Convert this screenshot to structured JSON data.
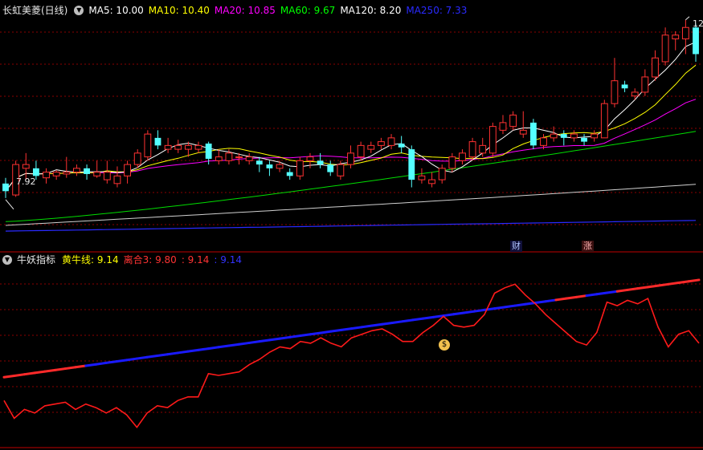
{
  "main_header": {
    "title": "长虹美菱(日线)",
    "ma": [
      {
        "label": "MA5: 10.00",
        "color": "#ffffff"
      },
      {
        "label": "MA10: 10.40",
        "color": "#ffff00"
      },
      {
        "label": "MA20: 10.85",
        "color": "#ff00ff"
      },
      {
        "label": "MA60: 9.67",
        "color": "#00ff00"
      },
      {
        "label": "MA120: 8.20",
        "color": "#ffffff"
      },
      {
        "label": "MA250: 7.33",
        "color": "#0000ff"
      }
    ]
  },
  "sub_header": {
    "title": "牛妖指标",
    "items": [
      {
        "label": "黄牛线: 9.14",
        "color": "#ffff00"
      },
      {
        "label": "离合3: 9.80",
        "color": "#ff3333"
      },
      {
        "label": ": 9.14",
        "color": "#ff3333"
      },
      {
        "label": ": 9.14",
        "color": "#3333ff"
      }
    ]
  },
  "badges": {
    "cai": "财",
    "zhang": "涨",
    "money": "$"
  },
  "price_labels": {
    "low": "7.92",
    "high": "12"
  },
  "colors": {
    "up": "#ff3232",
    "down": "#54ffff",
    "grid": "#8b0000",
    "border": "#c00000"
  },
  "chart_data": [
    {
      "type": "candlestick",
      "title": "长虹美菱(日线)",
      "ylim": [
        6.8,
        12.7
      ],
      "low_marker": 7.92,
      "high_marker": 12,
      "candles": [
        [
          8.3,
          8.1,
          8.45,
          7.92
        ],
        [
          8.0,
          8.8,
          8.9,
          7.95
        ],
        [
          8.7,
          8.8,
          9.1,
          8.4
        ],
        [
          8.7,
          8.5,
          8.9,
          8.4
        ],
        [
          8.45,
          8.6,
          8.7,
          8.3
        ],
        [
          8.5,
          8.6,
          8.65,
          8.4
        ],
        [
          8.55,
          8.6,
          9.0,
          8.45
        ],
        [
          8.6,
          8.7,
          8.8,
          8.5
        ],
        [
          8.7,
          8.55,
          8.8,
          8.4
        ],
        [
          8.5,
          8.6,
          8.9,
          8.45
        ],
        [
          8.4,
          8.6,
          8.9,
          8.3
        ],
        [
          8.3,
          8.5,
          8.75,
          8.2
        ],
        [
          8.5,
          8.8,
          8.9,
          8.3
        ],
        [
          8.8,
          9.1,
          9.2,
          8.7
        ],
        [
          9.0,
          9.6,
          9.7,
          8.9
        ],
        [
          9.5,
          9.3,
          9.7,
          9.2
        ],
        [
          9.2,
          9.3,
          9.5,
          9.1
        ],
        [
          9.2,
          9.3,
          9.45,
          9.1
        ],
        [
          9.2,
          9.3,
          9.4,
          9.0
        ],
        [
          9.2,
          9.3,
          9.4,
          9.1
        ],
        [
          9.35,
          8.95,
          9.4,
          8.8
        ],
        [
          8.9,
          9.0,
          9.2,
          8.8
        ],
        [
          8.9,
          9.1,
          9.2,
          8.8
        ],
        [
          9.0,
          9.0,
          9.1,
          8.8
        ],
        [
          8.9,
          9.0,
          9.1,
          8.8
        ],
        [
          8.9,
          8.8,
          9.0,
          8.6
        ],
        [
          8.8,
          8.7,
          8.9,
          8.5
        ],
        [
          8.7,
          8.8,
          8.9,
          8.6
        ],
        [
          8.6,
          8.5,
          8.7,
          8.4
        ],
        [
          8.5,
          8.9,
          9.0,
          8.4
        ],
        [
          8.9,
          9.0,
          9.1,
          8.7
        ],
        [
          8.9,
          8.8,
          9.1,
          8.7
        ],
        [
          8.8,
          8.6,
          8.9,
          8.5
        ],
        [
          8.5,
          8.8,
          8.9,
          8.4
        ],
        [
          8.8,
          9.1,
          9.3,
          8.7
        ],
        [
          9.0,
          9.3,
          9.4,
          8.9
        ],
        [
          9.2,
          9.3,
          9.4,
          9.1
        ],
        [
          9.3,
          9.4,
          9.5,
          9.2
        ],
        [
          9.3,
          9.5,
          9.6,
          9.2
        ],
        [
          9.35,
          9.25,
          9.55,
          9.1
        ],
        [
          9.2,
          8.4,
          9.3,
          8.2
        ],
        [
          8.4,
          8.5,
          8.7,
          8.3
        ],
        [
          8.3,
          8.4,
          8.6,
          8.2
        ],
        [
          8.4,
          8.7,
          8.8,
          8.3
        ],
        [
          8.7,
          9.0,
          9.1,
          8.6
        ],
        [
          8.9,
          9.1,
          9.2,
          8.8
        ],
        [
          9.0,
          9.4,
          9.5,
          8.9
        ],
        [
          9.1,
          9.3,
          9.5,
          9.0
        ],
        [
          9.1,
          9.8,
          9.9,
          9.0
        ],
        [
          9.7,
          9.9,
          10.1,
          9.6
        ],
        [
          9.8,
          10.1,
          10.2,
          9.7
        ],
        [
          9.6,
          9.7,
          10.2,
          9.5
        ],
        [
          9.9,
          9.3,
          10.0,
          9.2
        ],
        [
          9.3,
          9.5,
          9.6,
          9.2
        ],
        [
          9.5,
          9.6,
          9.8,
          9.4
        ],
        [
          9.6,
          9.5,
          9.7,
          9.3
        ],
        [
          9.5,
          9.6,
          9.7,
          9.4
        ],
        [
          9.5,
          9.4,
          9.6,
          9.3
        ],
        [
          9.5,
          9.6,
          9.7,
          9.4
        ],
        [
          9.5,
          10.4,
          10.5,
          9.5
        ],
        [
          10.4,
          11.0,
          11.6,
          10.3
        ],
        [
          10.9,
          10.8,
          11.0,
          10.7
        ],
        [
          10.6,
          10.7,
          10.8,
          10.5
        ],
        [
          10.7,
          11.1,
          11.3,
          10.6
        ],
        [
          11.1,
          11.6,
          11.8,
          11.0
        ],
        [
          11.5,
          12.2,
          12.4,
          11.4
        ],
        [
          12.1,
          12.2,
          12.3,
          11.8
        ],
        [
          12.1,
          12.4,
          12.6,
          11.7
        ],
        [
          12.4,
          11.7,
          12.5,
          11.5
        ]
      ]
    },
    {
      "type": "line",
      "title": "牛妖指标",
      "ylim": [
        0,
        100
      ],
      "series": [
        {
          "name": "黄牛线",
          "values": [
            38,
            38.8,
            39.6,
            40.4,
            41.2,
            42.0,
            42.8,
            43.6,
            44.4,
            45.2,
            46.0,
            46.8,
            47.6,
            48.4,
            49.2,
            50.0,
            50.8,
            51.6,
            52.4,
            53.2,
            54.0,
            54.8,
            55.6,
            56.4,
            57.2,
            58.0,
            58.8,
            59.6,
            60.4,
            61.2,
            62.0,
            62.8,
            63.6,
            64.4,
            65.2,
            66.0,
            66.8,
            67.6,
            68.4,
            69.2,
            70.0,
            70.8,
            71.6,
            72.4,
            73.2,
            74.0,
            74.8,
            75.6,
            76.4,
            77.2,
            78.0,
            78.8,
            79.6,
            80.4,
            81.2,
            82.0,
            82.8,
            83.6,
            84.4,
            85.2,
            86.0,
            86.8,
            87.6,
            88.4,
            89.2,
            90.0,
            90.8,
            91.6,
            92.4
          ]
        },
        {
          "name": "离合3",
          "values": [
            25,
            15,
            20,
            18,
            22,
            23,
            24,
            20,
            23,
            21,
            18,
            21,
            17,
            10,
            18,
            22,
            21,
            25,
            27,
            27,
            40,
            39,
            40,
            41,
            45,
            48,
            52,
            55,
            54,
            58,
            57,
            60,
            57,
            55,
            60,
            62,
            64,
            65,
            62,
            58,
            58,
            63,
            67,
            72,
            67,
            66,
            67,
            73,
            85,
            88,
            90,
            84,
            79,
            73,
            68,
            63,
            58,
            56,
            63,
            80,
            78,
            81,
            79,
            82,
            66,
            55,
            62,
            64,
            57
          ]
        }
      ]
    }
  ]
}
